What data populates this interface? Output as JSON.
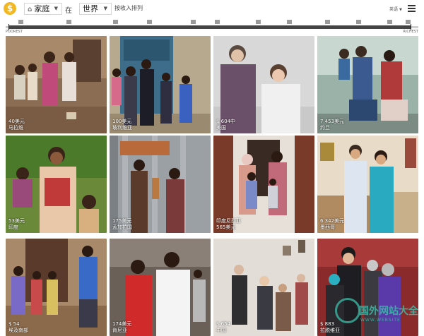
{
  "header": {
    "logo_symbol": "$",
    "category_select": "家庭",
    "connector": "在",
    "region_select": "世界",
    "income_label": "按收入排列",
    "language": "英语"
  },
  "income_strip": {
    "poorest": "POOREST",
    "richest": "RICHEST"
  },
  "families": [
    {
      "caption_line1": "40美元",
      "caption_line2": "马拉维"
    },
    {
      "caption_line1": "100美元",
      "caption_line2": "玻利维亚"
    },
    {
      "caption_line1": "$ 604中",
      "caption_line2": "美国"
    },
    {
      "caption_line1": "7 453美元",
      "caption_line2": "约旦"
    },
    {
      "caption_line1": "53美元",
      "caption_line2": "印度"
    },
    {
      "caption_line1": "175美元",
      "caption_line2": "孟加拉国"
    },
    {
      "caption_line1": "印度尼西亚",
      "caption_line2": "565美元"
    },
    {
      "caption_line1": "6 342美元",
      "caption_line2": "墨西哥"
    },
    {
      "caption_line1": "$ 54",
      "caption_line2": "埃及南部"
    },
    {
      "caption_line1": "174美元",
      "caption_line2": "肯尼亚"
    },
    {
      "caption_line1": "$ 654",
      "caption_line2": "中国"
    },
    {
      "caption_line1": "$ 883",
      "caption_line2": "拉脱维亚"
    }
  ],
  "watermark": {
    "text": "国外网站大全",
    "sub": "WWW.WEBSITE"
  },
  "colors": {
    "logo": "#f2b824",
    "watermark": "#3cbeaa"
  },
  "icons": [
    "dollar-logo-icon",
    "house-icon",
    "chevron-down-icon",
    "menu-icon"
  ]
}
